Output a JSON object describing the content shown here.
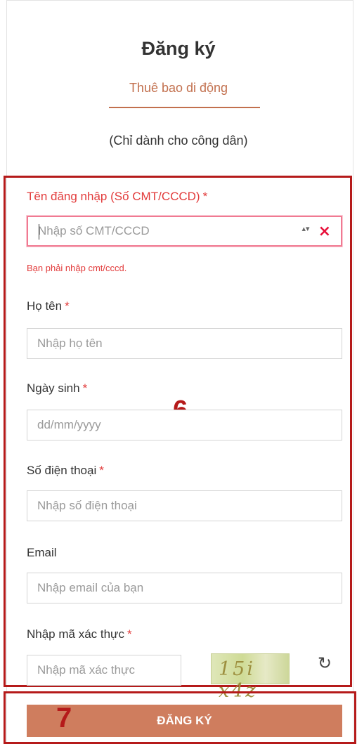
{
  "header": {
    "title": "Đăng ký",
    "subtitle": "Thuê bao di động",
    "note": "(Chỉ dành cho công dân)"
  },
  "form": {
    "id_label": "Tên đăng nhập (Số CMT/CCCD)",
    "id_placeholder": "Nhập số CMT/CCCD",
    "id_error": "Bạn phải nhập cmt/cccd.",
    "name_label": "Họ tên",
    "name_placeholder": "Nhập họ tên",
    "dob_label": "Ngày sinh",
    "dob_placeholder": "dd/mm/yyyy",
    "phone_label": "Số điện thoại",
    "phone_placeholder": "Nhập số điện thoại",
    "email_label": "Email",
    "email_placeholder": "Nhập email của bạn",
    "captcha_label": "Nhập mã xác thực",
    "captcha_placeholder": "Nhập mã xác thực",
    "captcha_text": "15i x4z",
    "required_mark": "*",
    "submit_label": "ĐĂNG KÝ"
  },
  "annotations": {
    "box6_label": "6",
    "box7_label": "7",
    "box_color": "#b51a1a"
  },
  "icons": {
    "clear": "×",
    "spinner": "▴▾",
    "refresh": "↻"
  },
  "colors": {
    "accent": "#c2704e",
    "button": "#cf7d5e",
    "error": "#e23b3b"
  }
}
